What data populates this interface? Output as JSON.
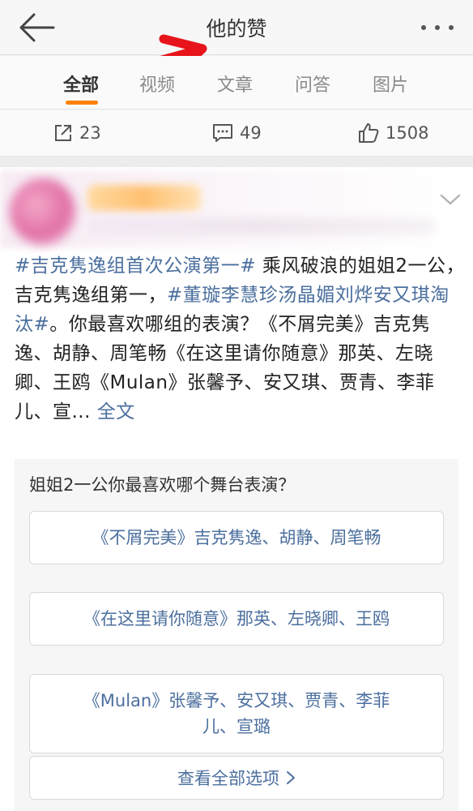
{
  "nav": {
    "title": "他的赞",
    "back_icon": "arrow-left-icon",
    "more_icon": "more-dots-icon"
  },
  "tabs": [
    {
      "label": "全部",
      "active": true
    },
    {
      "label": "视频",
      "active": false
    },
    {
      "label": "文章",
      "active": false
    },
    {
      "label": "问答",
      "active": false
    },
    {
      "label": "图片",
      "active": false
    }
  ],
  "stats": {
    "shares": "23",
    "comments": "49",
    "likes": "1508"
  },
  "post": {
    "topic1": "#吉克隽逸组首次公演第一#",
    "text1": " 乘风破浪的姐姐2一公，吉克隽逸组第一，",
    "topic2": "#董璇李慧珍汤晶媚刘烨安又琪淘汰#",
    "text2": "。你最喜欢哪组的表演？《不屑完美》吉克隽逸、胡静、周笔畅《在这里请你随意》那英、左晓卿、王鸥《Mulan》张馨予、安又琪、贾青、李菲儿、宣...",
    "fulltext_link": "全文"
  },
  "poll": {
    "question": "姐姐2一公你最喜欢哪个舞台表演？",
    "options": [
      "《不屑完美》吉克隽逸、胡静、周笔畅",
      "《在这里请你随意》那英、左晓卿、王鸥",
      "《Mulan》张馨予、安又琪、贾青、李菲儿、宣璐"
    ],
    "view_all": "查看全部选项"
  },
  "colors": {
    "accent": "#ff8200",
    "link": "#4b6f9e",
    "annotation_arrow": "#e8141b"
  }
}
